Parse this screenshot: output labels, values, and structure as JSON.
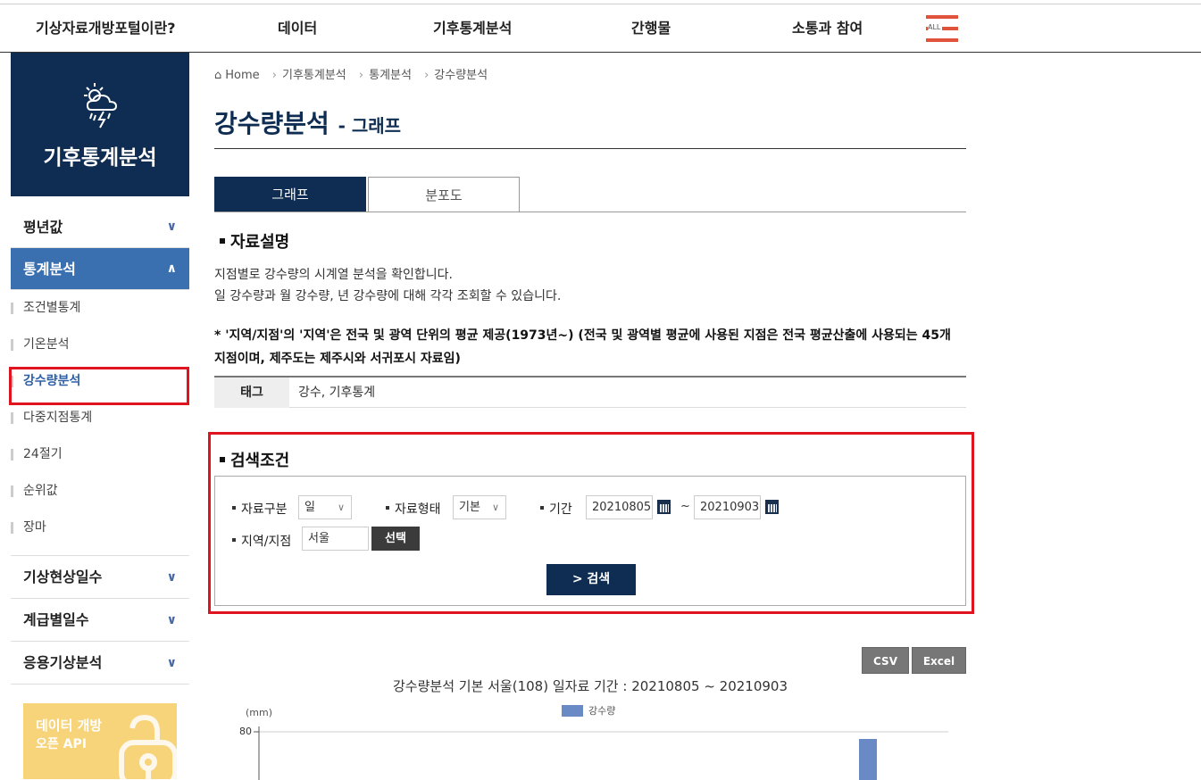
{
  "gnb": {
    "items": [
      "기상자료개방포털이란?",
      "데이터",
      "기후통계분석",
      "간행물",
      "소통과 참여"
    ],
    "all_label": "ALL"
  },
  "sidebar": {
    "title": "기후통계분석",
    "menus": [
      {
        "label": "평년값",
        "expanded": false
      },
      {
        "label": "통계분석",
        "expanded": true
      },
      {
        "label": "기상현상일수",
        "expanded": false
      },
      {
        "label": "계급별일수",
        "expanded": false
      },
      {
        "label": "응용기상분석",
        "expanded": false
      }
    ],
    "submenu": [
      "조건별통계",
      "기온분석",
      "강수량분석",
      "다중지점통계",
      "24절기",
      "순위값",
      "장마"
    ],
    "active_sub": "강수량분석",
    "banner": {
      "line1": "데이터 개방",
      "line2": "오픈 API"
    }
  },
  "breadcrumb": {
    "home": "Home",
    "items": [
      "기후통계분석",
      "통계분석",
      "강수량분석"
    ]
  },
  "page": {
    "title": "강수량분석",
    "subtitle": "- 그래프"
  },
  "tabs": [
    "그래프",
    "분포도"
  ],
  "description": {
    "heading": "자료설명",
    "line1": "지점별로 강수량의 시계열 분석을 확인합니다.",
    "line2": "일 강수량과 월 강수량, 년 강수량에 대해 각각 조회할 수 있습니다.",
    "note": "* '지역/지점'의 '지역'은 전국 및 광역 단위의 평균 제공(1973년~) (전국 및 광역별 평균에 사용된 지점은 전국 평균산출에 사용되는 45개 지점이며, 제주도는 제주시와 서귀포시 자료임)"
  },
  "tag": {
    "label": "태그",
    "value": "강수, 기후통계"
  },
  "search": {
    "heading": "검색조건",
    "data_type_label": "자료구분",
    "data_type_value": "일",
    "data_form_label": "자료형태",
    "data_form_value": "기본",
    "period_label": "기간",
    "start_date": "20210805",
    "end_date": "20210903",
    "tilde": "~",
    "station_label": "지역/지점",
    "station_value": "서울",
    "select_button": "선택",
    "search_button": "> 검색"
  },
  "downloads": {
    "csv": "CSV",
    "excel": "Excel"
  },
  "chart_data": {
    "type": "bar",
    "title": "강수량분석 기본 서울(108) 일자료 기간 : 20210805 ~ 20210903",
    "ylabel": "(mm)",
    "legend": [
      "강수량"
    ],
    "yticks": [
      "80"
    ],
    "series_color": "#6a8ac6"
  }
}
